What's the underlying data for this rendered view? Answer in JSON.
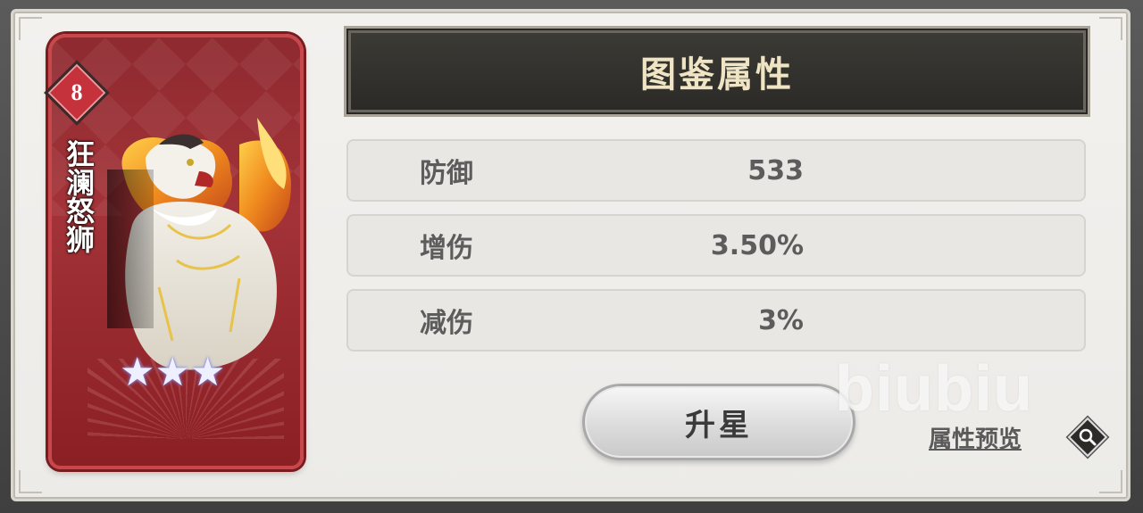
{
  "card": {
    "level": "8",
    "name": "狂澜怒狮",
    "stars": [
      "★",
      "★",
      "★"
    ]
  },
  "panel": {
    "title": "图鉴属性"
  },
  "stats": [
    {
      "label": "防御",
      "value": "533"
    },
    {
      "label": "增伤",
      "value": "3.50%"
    },
    {
      "label": "减伤",
      "value": "3%"
    }
  ],
  "actions": {
    "upgrade_label": "升星",
    "preview_label": "属性预览",
    "preview_icon": "magnifier-icon"
  },
  "watermark": "biubiu",
  "colors": {
    "card_red": "#a33338",
    "header_dark": "#2c2a26",
    "header_text": "#efe4c4",
    "stat_text": "#5c5c5c"
  }
}
